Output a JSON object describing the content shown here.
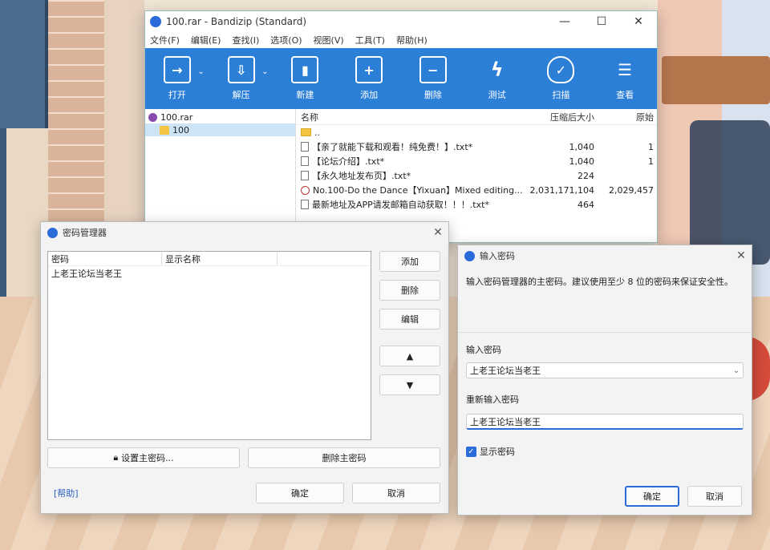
{
  "bandizip": {
    "title": "100.rar - Bandizip (Standard)",
    "window_controls": [
      "—",
      "☐",
      "✕"
    ],
    "menu": [
      "文件(F)",
      "编辑(E)",
      "查找(I)",
      "选项(O)",
      "视图(V)",
      "工具(T)",
      "帮助(H)"
    ],
    "toolbar": [
      {
        "label": "打开",
        "icon": "open-icon"
      },
      {
        "label": "解压",
        "icon": "extract-icon"
      },
      {
        "label": "新建",
        "icon": "new-archive-icon"
      },
      {
        "label": "添加",
        "icon": "add-icon"
      },
      {
        "label": "删除",
        "icon": "delete-icon"
      },
      {
        "label": "测试",
        "icon": "test-icon"
      },
      {
        "label": "扫描",
        "icon": "scan-icon"
      },
      {
        "label": "查看",
        "icon": "view-icon"
      }
    ],
    "tree": [
      {
        "label": "100.rar"
      },
      {
        "label": "100"
      }
    ],
    "columns": {
      "name": "名称",
      "compressed": "压缩后大小",
      "original": "原始"
    },
    "files": [
      {
        "name": "..",
        "compressed": "",
        "original": "",
        "type": "folder"
      },
      {
        "name": "【亲了就能下载和观看！纯免费！】.txt*",
        "compressed": "1,040",
        "original": "1",
        "type": "txt"
      },
      {
        "name": "【论坛介绍】.txt*",
        "compressed": "1,040",
        "original": "1",
        "type": "txt"
      },
      {
        "name": "【永久地址发布页】.txt*",
        "compressed": "224",
        "original": "",
        "type": "txt"
      },
      {
        "name": "No.100-Do the Dance【Yixuan】Mixed editing...",
        "compressed": "2,031,171,104",
        "original": "2,029,457",
        "type": "video"
      },
      {
        "name": "最新地址及APP请发邮箱自动获取！！！.txt*",
        "compressed": "464",
        "original": "",
        "type": "txt"
      }
    ]
  },
  "password_manager": {
    "title": "密码管理器",
    "col_password": "密码",
    "col_display_name": "显示名称",
    "entries": [
      {
        "password": "上老王论坛当老王",
        "display_name": ""
      }
    ],
    "buttons": {
      "add": "添加",
      "delete": "删除",
      "edit": "编辑",
      "up": "▲",
      "down": "▼",
      "set_master": "设置主密码...",
      "delete_master": "删除主密码",
      "ok": "确定",
      "cancel": "取消"
    },
    "help": "[帮助]"
  },
  "enter_password": {
    "title": "输入密码",
    "description": "输入密码管理器的主密码。建议使用至少 8 位的密码来保证安全性。",
    "label_password": "输入密码",
    "password_value": "上老王论坛当老王",
    "label_reenter": "重新输入密码",
    "reenter_value": "上老王论坛当老王",
    "show_password": "显示密码",
    "show_password_checked": true,
    "ok": "确定",
    "cancel": "取消"
  },
  "colors": {
    "accent": "#2c7fd6",
    "selection": "#cde4f7"
  }
}
